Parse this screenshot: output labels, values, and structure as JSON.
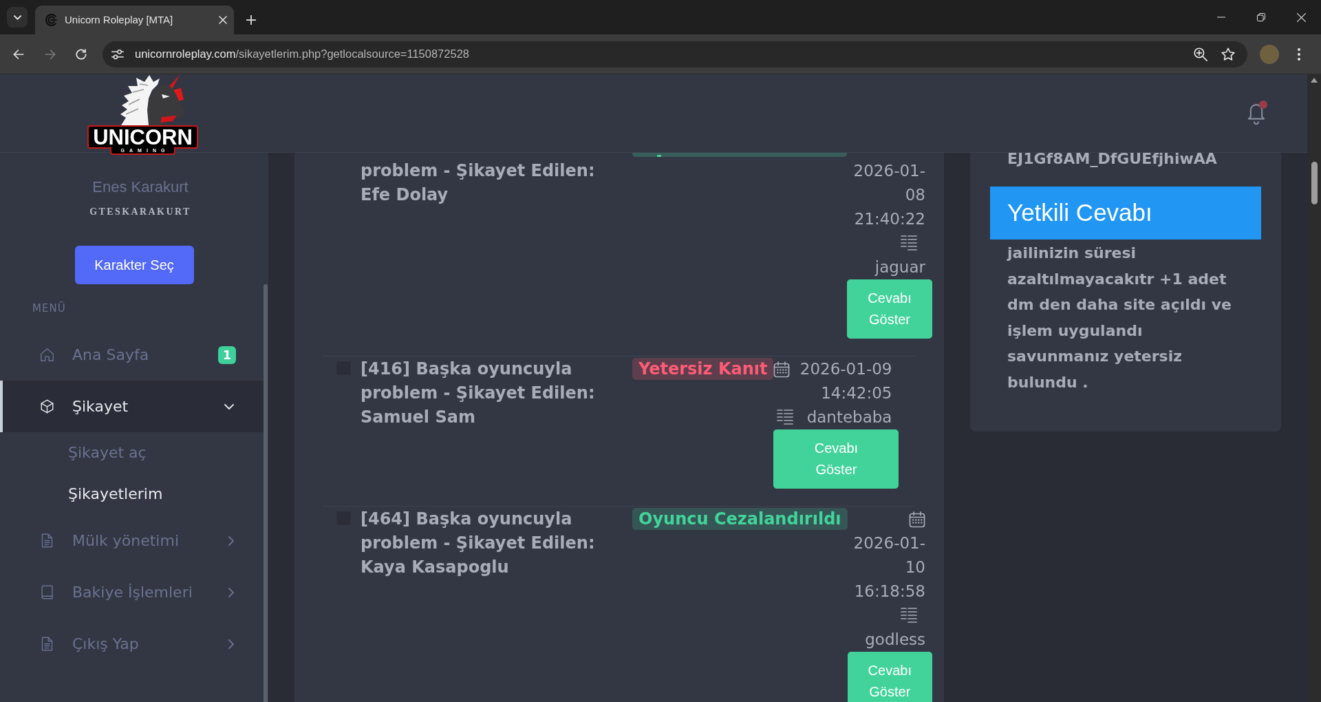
{
  "browser": {
    "tab": {
      "title": "Unicorn Roleplay [MTA]",
      "selected": true
    },
    "back": {
      "disabled": false
    },
    "forward": {
      "disabled": true
    },
    "url": {
      "host": "unicornroleplay.com",
      "path": "/sikayetlerim.php?getlocalsource=1150872528"
    }
  },
  "header": {
    "logo": {
      "wordmark": "UNICORN",
      "tagline": "GAMING"
    },
    "notifications": {
      "unread": true
    }
  },
  "sidebar": {
    "user": {
      "name": "Enes Karakurt",
      "username": "GTESKARAKURT"
    },
    "character_button": "Karakter Seç",
    "menu_heading": "MENÜ",
    "menu": [
      {
        "label": "Ana Sayfa",
        "badge": "1",
        "selected": false
      },
      {
        "label": "Şikayet",
        "selected": true,
        "expanded": true,
        "children": [
          {
            "label": "Şikayet aç",
            "selected": false
          },
          {
            "label": "Şikayetlerim",
            "selected": true
          }
        ]
      },
      {
        "label": "Mülk yönetimi",
        "selected": false,
        "expanded": false
      },
      {
        "label": "Bakiye İşlemleri",
        "selected": false,
        "expanded": false
      },
      {
        "label": "Çıkış Yap",
        "selected": false,
        "expanded": false
      }
    ]
  },
  "complaints": [
    {
      "clipped_top": true,
      "title": "problem - Şikayet Edilen: Efe Dolay",
      "status": {
        "kind": "success"
      },
      "date": "2026-01-08 21:40:22",
      "user": "jaguar",
      "button": "Cevabı Göster"
    },
    {
      "clipped_top": false,
      "checked": false,
      "title": "[416] Başka oyuncuyla problem - Şikayet Edilen: Samuel Sam",
      "status": {
        "label": "Yetersiz Kanıt",
        "kind": "danger"
      },
      "date": "2026-01-09 14:42:05",
      "user": "dantebaba",
      "button": "Cevabı Göster"
    },
    {
      "clipped_top": false,
      "checked": false,
      "title": "[464] Başka oyuncuyla problem - Şikayet Edilen: Kaya Kasapoglu",
      "status": {
        "label": "Oyuncu Cezalandırıldı",
        "kind": "success"
      },
      "date": "2026-01-10 16:18:58",
      "user": "godless",
      "button": "Cevabı Göster"
    }
  ],
  "response_panel": {
    "partial_text": "EJ1Gf8AM_DfGUEfjhiwAA",
    "heading": "Yetkili Cevabı",
    "text": "jailinizin süresi azaltılmayacakıtr +1 adet dm den daha site açıldı ve işlem uygulandı savunmanız yetersiz bulundu ."
  }
}
